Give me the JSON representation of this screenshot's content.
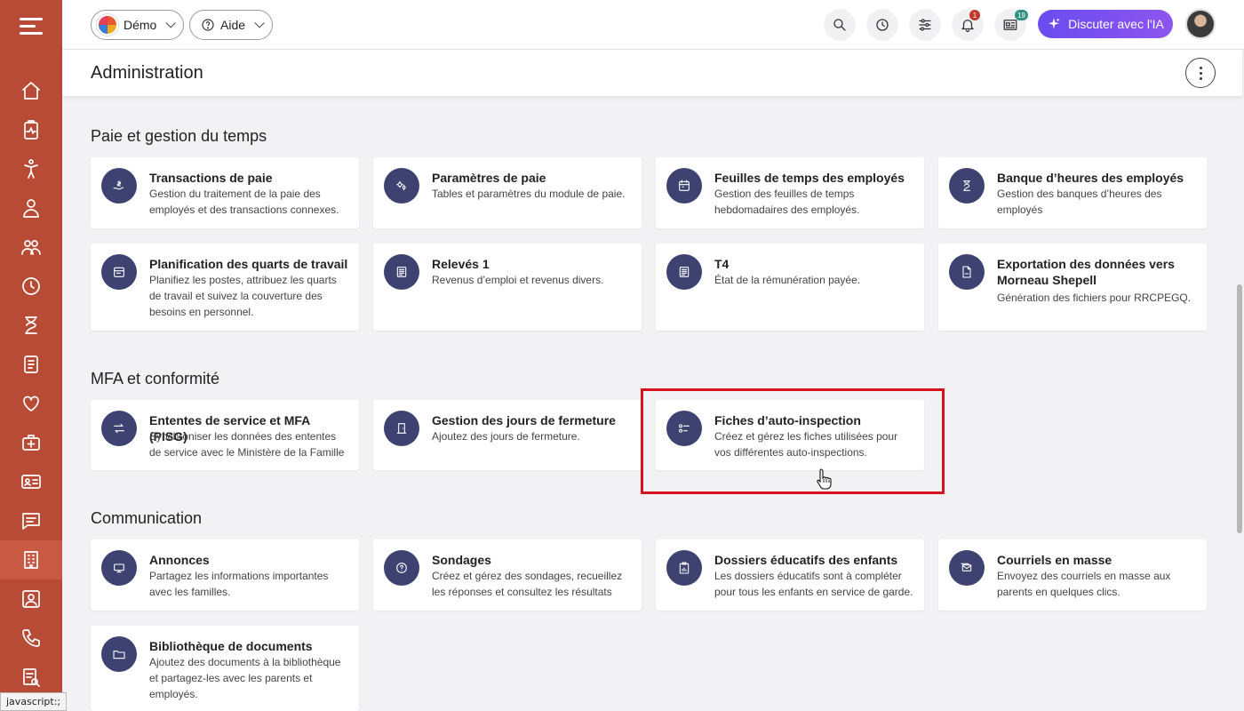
{
  "topbar": {
    "demo_label": "Démo",
    "help_label": "Aide",
    "notif_badge": "1",
    "news_badge": "19",
    "ai_label": "Discuter avec l'IA"
  },
  "header": {
    "title": "Administration"
  },
  "sections": [
    {
      "title": "Paie et gestion du temps"
    },
    {
      "title": "MFA et conformité"
    },
    {
      "title": "Communication"
    }
  ],
  "cards": {
    "transactions": {
      "title": "Transactions de paie",
      "desc": "Gestion du traitement de la paie des employés et des transactions connexes.",
      "icon": "payroll-hand-icon"
    },
    "parametres": {
      "title": "Paramètres de paie",
      "desc": "Tables et paramètres du module de paie.",
      "icon": "gears-icon"
    },
    "feuilles": {
      "title": "Feuilles de temps des employés",
      "desc": "Gestion des feuilles de temps hebdomadaires des employés.",
      "icon": "calendar-icon"
    },
    "banque": {
      "title": "Banque d’heures des employés",
      "desc": "Gestion des banques d’heures des employés",
      "icon": "hourglass-icon"
    },
    "planification": {
      "title": "Planification des quarts de travail",
      "desc": "Planifiez les postes, attribuez les quarts de travail et suivez la couverture des besoins en personnel.",
      "icon": "schedule-icon"
    },
    "releves": {
      "title": "Relevés 1",
      "desc": "Revenus d’emploi et revenus divers.",
      "icon": "document-icon"
    },
    "t4": {
      "title": "T4",
      "desc": "État de la rémunération payée.",
      "icon": "document-icon"
    },
    "exportation": {
      "title": "Exportation des données vers Morneau Shepell",
      "desc": "Génération des fichiers pour RRCPEGQ.",
      "icon": "csv-file-icon"
    },
    "ententes": {
      "title": "Ententes de service et MFA (PISG)",
      "desc": "Synchroniser les données des ententes de service avec le Ministère de la Famille",
      "icon": "sync-arrows-icon"
    },
    "fermeture": {
      "title": "Gestion des jours de fermeture",
      "desc": "Ajoutez des jours de fermeture.",
      "icon": "door-icon"
    },
    "fiches": {
      "title": "Fiches d’auto-inspection",
      "desc": "Créez et gérez les fiches utilisées pour vos différentes auto-inspections.",
      "icon": "checklist-icon"
    },
    "annonces": {
      "title": "Annonces",
      "desc": "Partagez les informations importantes avec les familles.",
      "icon": "monitor-icon"
    },
    "sondages": {
      "title": "Sondages",
      "desc": "Créez et gérez des sondages, recueillez les réponses et consultez les résultats",
      "icon": "question-icon"
    },
    "dossiers": {
      "title": "Dossiers éducatifs des enfants",
      "desc": "Les dossiers éducatifs sont à compléter pour tous les enfants en service de garde.",
      "icon": "report-icon"
    },
    "courriels": {
      "title": "Courriels en masse",
      "desc": "Envoyez des courriels en masse aux parents en quelques clics.",
      "icon": "mass-mail-icon"
    },
    "bibliotheque": {
      "title": "Bibliothèque de documents",
      "desc": "Ajoutez des documents à la bibliothèque et partagez-les avec les parents et employés.",
      "icon": "folder-icon"
    }
  },
  "status_bar": "javascript:;",
  "colors": {
    "sidebar": "#b74b35",
    "accent_icon_bg": "#3d4270",
    "highlight": "#d7141e",
    "ai_gradient_start": "#6a4cf0"
  }
}
